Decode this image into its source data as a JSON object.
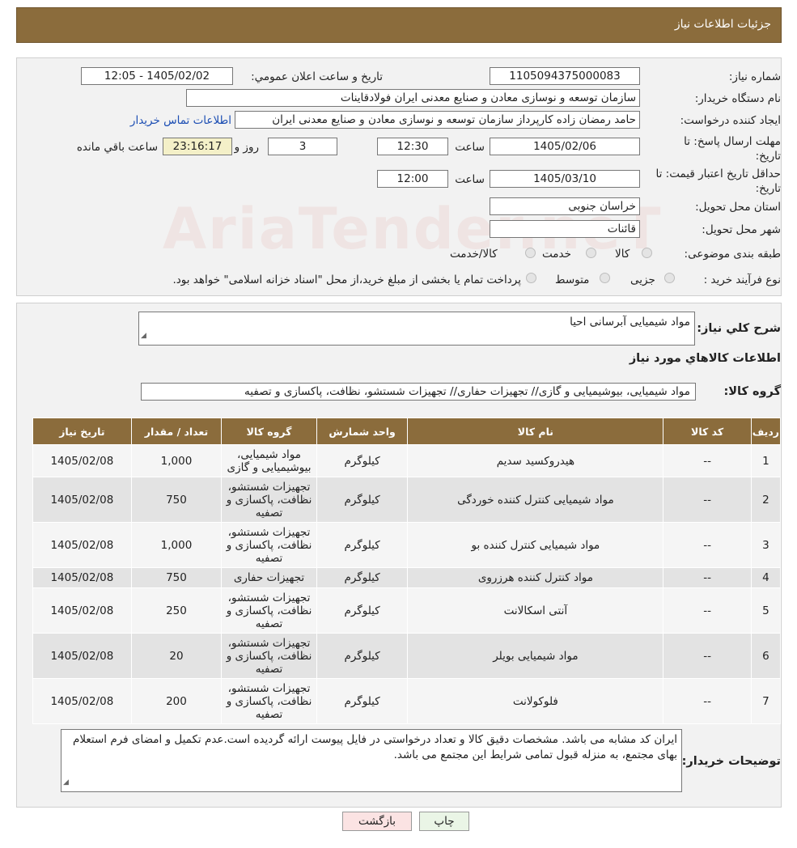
{
  "header": {
    "title": "جزئیات اطلاعات نیاز"
  },
  "watermark": "AriaTender.neT",
  "info": {
    "need_number_label": "شماره نیاز:",
    "need_number": "1105094375000083",
    "announce_label": "تاریخ و ساعت اعلان عمومي:",
    "announce_value": "1405/02/02 - 12:05",
    "buyer_org_label": "نام دستگاه خريدار:",
    "buyer_org": "سازمان توسعه و نوسازی معادن و صنایع معدنی ایران فولادقاینات",
    "creator_label": "ايجاد کننده درخواست:",
    "creator": "حامد  رمضان زاده  کارپرداز  سازمان توسعه و نوسازی معادن و صنایع معدنی ایران",
    "contact_link": "اطلاعات تماس خريدار",
    "reply_deadline_label": "مهلت ارسال پاسخ: تا تاریخ:",
    "reply_date": "1405/02/06",
    "time_label": "ساعت",
    "reply_time": "12:30",
    "days_value": "3",
    "days_label": "روز و",
    "remaining_time": "23:16:17",
    "remaining_label": "ساعت باقي مانده",
    "price_valid_label": "حداقل تاريخ اعتبار قيمت: تا تاریخ:",
    "price_valid_date": "1405/03/10",
    "price_valid_time": "12:00",
    "province_label": "استان محل تحويل:",
    "province": "خراسان جنوبی",
    "city_label": "شهر محل تحويل:",
    "city": "قائنات",
    "category_label": "طبقه بندی موضوعی:",
    "category_options": [
      "کالا",
      "خدمت",
      "کالا/خدمت"
    ],
    "purchase_type_label": "نوع فرآيند خريد :",
    "purchase_options": [
      "جزیی",
      "متوسط"
    ],
    "purchase_note": "پرداخت تمام یا بخشی از مبلغ خرید،از محل \"اسناد خزانه اسلامی\" خواهد بود."
  },
  "details": {
    "summary_label": "شرح کلي نياز:",
    "summary": "مواد شیمیایی آبرسانی احیا",
    "items_title": "اطلاعات کالاهاي مورد نياز",
    "group_label": "گروه کالا:",
    "group_value": "مواد شیمیایی، بیوشیمیایی و  گازی// تجهیزات حفاری// تجهیزات شستشو، نظافت، پاکسازی و تصفیه",
    "columns": [
      "رديف",
      "کد کالا",
      "نام کالا",
      "واحد شمارش",
      "گروه کالا",
      "تعداد / مقدار",
      "تاريخ نياز"
    ],
    "rows": [
      {
        "row": "1",
        "code": "--",
        "name": "هیدروکسید سدیم",
        "unit": "کیلوگرم",
        "group": "مواد شیمیایی، بیوشیمیایی و گازی",
        "qty": "1,000",
        "date": "1405/02/08"
      },
      {
        "row": "2",
        "code": "--",
        "name": "مواد شیمیایی کنترل کننده خوردگی",
        "unit": "کیلوگرم",
        "group": "تجهیزات شستشو، نظافت، پاکسازی و تصفیه",
        "qty": "750",
        "date": "1405/02/08"
      },
      {
        "row": "3",
        "code": "--",
        "name": "مواد شیمیایی کنترل کننده بو",
        "unit": "کیلوگرم",
        "group": "تجهیزات شستشو، نظافت، پاکسازی و تصفیه",
        "qty": "1,000",
        "date": "1405/02/08"
      },
      {
        "row": "4",
        "code": "--",
        "name": "مواد کنترل کننده هرزروی",
        "unit": "کیلوگرم",
        "group": "تجهیزات حفاری",
        "qty": "750",
        "date": "1405/02/08"
      },
      {
        "row": "5",
        "code": "--",
        "name": "آنتی اسکالانت",
        "unit": "کیلوگرم",
        "group": "تجهیزات شستشو، نظافت، پاکسازی و تصفیه",
        "qty": "250",
        "date": "1405/02/08"
      },
      {
        "row": "6",
        "code": "--",
        "name": "مواد شیمیایی بویلر",
        "unit": "کیلوگرم",
        "group": "تجهیزات شستشو، نظافت، پاکسازی و تصفیه",
        "qty": "20",
        "date": "1405/02/08"
      },
      {
        "row": "7",
        "code": "--",
        "name": "فلوکولانت",
        "unit": "کیلوگرم",
        "group": "تجهیزات شستشو، نظافت، پاکسازی و تصفیه",
        "qty": "200",
        "date": "1405/02/08"
      }
    ],
    "notes_label": "توضيحات خريدار:",
    "notes": "ایران کد مشابه می باشد. مشخصات دقیق کالا و تعداد درخواستی در فایل پیوست ارائه گردیده است.عدم تکمیل و امضای فرم استعلام بهای مجتمع، به منزله قبول تمامی شرایط این مجتمع می باشد."
  },
  "buttons": {
    "print": "چاپ",
    "back": "بازگشت"
  }
}
